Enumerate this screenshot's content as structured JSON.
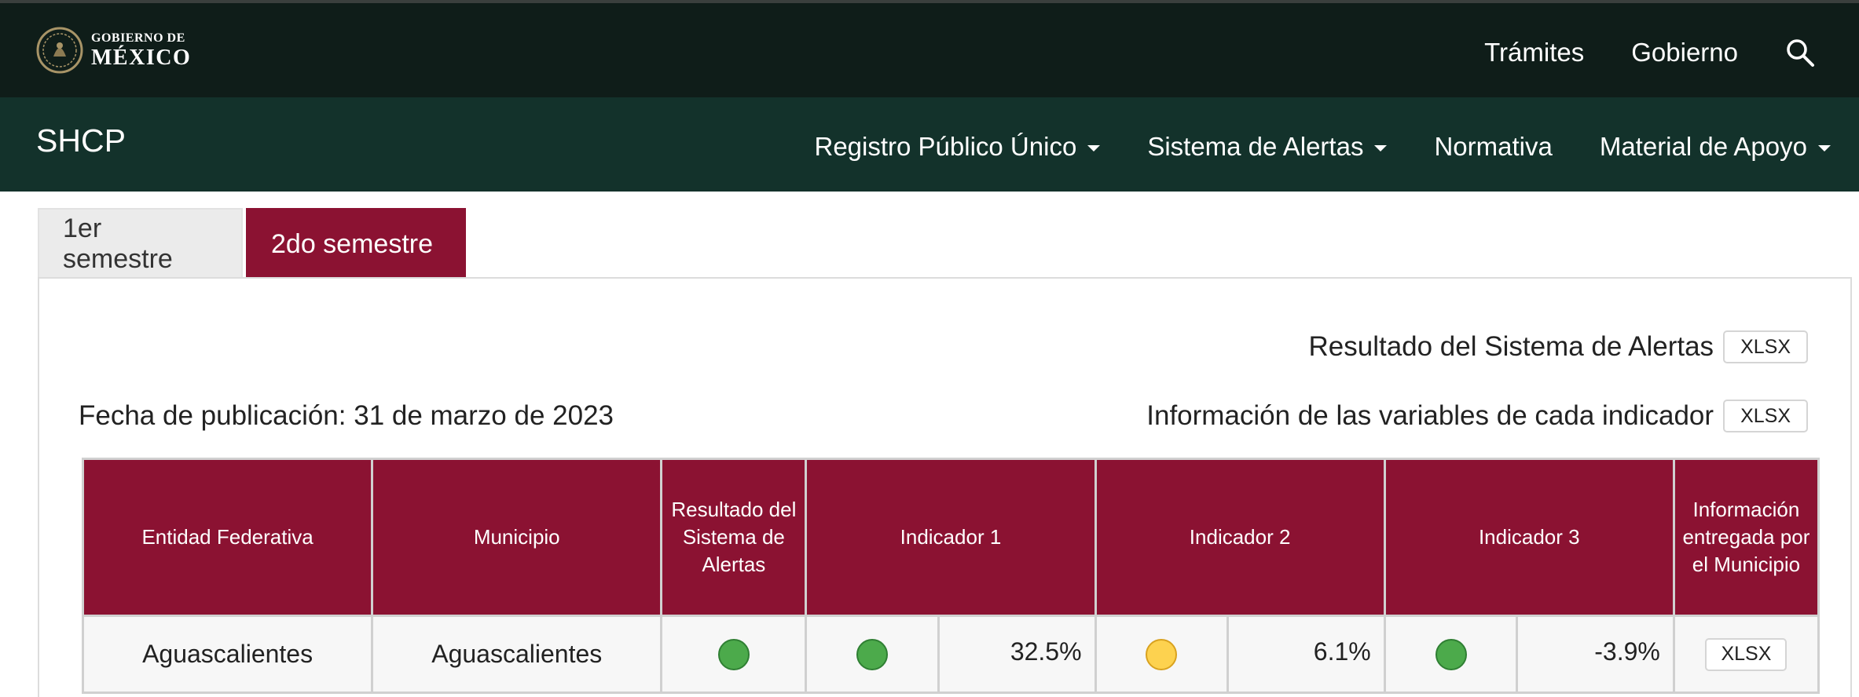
{
  "gov_bar": {
    "logo_small": "GOBIERNO DE",
    "logo_big": "MÉXICO",
    "links": [
      "Trámites",
      "Gobierno"
    ]
  },
  "main_nav": {
    "brand": "SHCP",
    "items": [
      {
        "label": "Registro Público Único",
        "dropdown": true
      },
      {
        "label": "Sistema de Alertas",
        "dropdown": true
      },
      {
        "label": "Normativa",
        "dropdown": false
      },
      {
        "label": "Material de Apoyo",
        "dropdown": true
      }
    ]
  },
  "tabs": [
    {
      "label": "1er semestre",
      "active": false
    },
    {
      "label": "2do semestre",
      "active": true
    }
  ],
  "panel": {
    "result_line": "Resultado del Sistema de Alertas",
    "variables_line": "Información de las variables de cada indicador",
    "xlsx_label": "XLSX",
    "pub_date": "Fecha de publicación: 31 de marzo de 2023"
  },
  "table": {
    "headers": [
      "Entidad Federativa",
      "Municipio",
      "Resultado del Sistema de Alertas",
      "Indicador 1",
      "Indicador 2",
      "Indicador 3",
      "Información entregada por el Municipio"
    ],
    "rows": [
      {
        "entidad": "Aguascalientes",
        "municipio": "Aguascalientes",
        "resultado_status": "green",
        "ind1_status": "green",
        "ind1_value": "32.5%",
        "ind2_status": "yellow",
        "ind2_value": "6.1%",
        "ind3_status": "green",
        "ind3_value": "-3.9%",
        "info_label": "XLSX"
      }
    ]
  },
  "colors": {
    "gov_bar_bg": "#0f1d19",
    "nav_bg": "#13322b",
    "accent_maroon": "#8b1232",
    "status_green": "#4caa4b",
    "status_yellow": "#fdd24f"
  }
}
